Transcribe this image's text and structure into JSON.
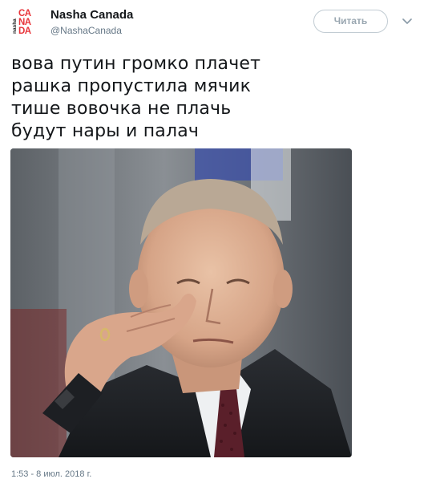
{
  "author": {
    "name": "Nasha Canada",
    "handle": "@NashaCanada",
    "avatar_logo": {
      "prefix": "nasha",
      "line1": "CA",
      "line2": "NA",
      "line3": "DA",
      "accent": "#e8343a"
    }
  },
  "follow_button": {
    "label": "Читать"
  },
  "more_menu": {
    "icon": "chevron-down-icon"
  },
  "tweet": {
    "lines": [
      "вова путин громко плачет",
      "рашка пропустила мячик",
      "тише вовочка не плачь",
      "будут нары и палач"
    ]
  },
  "media": {
    "type": "photo"
  },
  "timestamp": "1:53 - 8 июл. 2018 г.",
  "colors": {
    "text": "#14171a",
    "secondary": "#657786",
    "border": "#c2ccd3",
    "brand_red": "#e8343a"
  }
}
